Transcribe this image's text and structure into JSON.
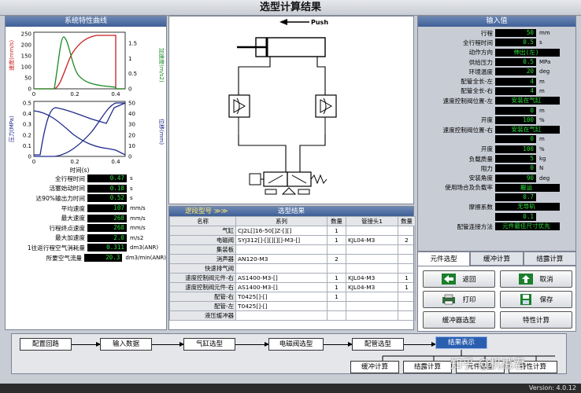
{
  "window": {
    "title": "选型计算结果",
    "version": "Version: 4.0.12"
  },
  "left_panel": {
    "header": "系统特性曲线",
    "chart1": {
      "ylabel_left": "速度(mm/s)",
      "ylabel_right": "加速度(m/s2)",
      "yticks_left": [
        "250",
        "200",
        "150",
        "100",
        "50",
        "0"
      ],
      "yticks_right": [
        "1.5",
        "1",
        "0.5",
        "0"
      ],
      "xticks": [
        "0",
        "0.2",
        "0.4"
      ]
    },
    "chart2": {
      "ylabel_left": "压力(MPa)",
      "ylabel_right": "位移(mm)",
      "yticks_left": [
        "0.5",
        "0.4",
        "0.3",
        "0.2",
        "0.1",
        "0"
      ],
      "yticks_right": [
        "50",
        "40",
        "30",
        "20",
        "10",
        "0"
      ],
      "xticks": [
        "0",
        "0.2",
        "0.4"
      ],
      "xlabel": "时间(s)"
    },
    "params": [
      {
        "label": "全行程时间",
        "value": "0.47",
        "unit": "s"
      },
      {
        "label": "活塞始动时间",
        "value": "0.18",
        "unit": "s"
      },
      {
        "label": "达90%输出力时间",
        "value": "0.52",
        "unit": "s"
      },
      {
        "label": "平均速度",
        "value": "107",
        "unit": "mm/s"
      },
      {
        "label": "最大速度",
        "value": "268",
        "unit": "mm/s"
      },
      {
        "label": "行程终点速度",
        "value": "268",
        "unit": "mm/s"
      },
      {
        "label": "最大加速度",
        "value": "2.0",
        "unit": "m/s2"
      },
      {
        "label": "1往返行程空气消耗量",
        "value": "0.311",
        "unit": "dm3(ANR)"
      },
      {
        "label": "所要空气流量",
        "value": "20.3",
        "unit": "dm3/min(ANR)"
      }
    ]
  },
  "center": {
    "push_label": "Push"
  },
  "table": {
    "tab_left": "逻段型号 ≫≫",
    "tab_center": "选型结果",
    "headers": [
      "名称",
      "系列",
      "数量",
      "管接头1",
      "数量"
    ],
    "rows": [
      [
        "气缸",
        "CJ2L[]16-50[]Z-[][]",
        "1",
        "",
        ""
      ],
      [
        "电磁阀",
        "SYJ312[]-[][][][]-M3-[]",
        "1",
        "KJL04-M3",
        "2"
      ],
      [
        "集装板",
        "",
        "",
        "",
        ""
      ],
      [
        "消声器",
        "AN120-M3",
        "2",
        "",
        ""
      ],
      [
        "快速排气阀",
        "",
        "",
        "",
        ""
      ],
      [
        "速度控制阀元件-右",
        "AS1400-M3-[]",
        "1",
        "KJL04-M3",
        "1"
      ],
      [
        "速度控制阀元件-右",
        "AS1400-M3-[]",
        "1",
        "KJL04-M3",
        "1"
      ],
      [
        "配管-右",
        "T0425[]-[]",
        "1",
        "",
        ""
      ],
      [
        "配管-左",
        "T0425[]-[]",
        "",
        "",
        ""
      ],
      [
        "液压缓冲器",
        "",
        "",
        "",
        ""
      ]
    ]
  },
  "right_panel": {
    "header": "输入值",
    "inputs": [
      {
        "label": "行程",
        "value": "50",
        "unit": "mm"
      },
      {
        "label": "全行程时间",
        "value": "0.5",
        "unit": "s"
      },
      {
        "label": "动作方向",
        "value": "伸出(左)",
        "unit": "",
        "wide": true
      },
      {
        "label": "供给压力",
        "value": "0.5",
        "unit": "MPa"
      },
      {
        "label": "环境温度",
        "value": "20",
        "unit": "deg"
      },
      {
        "label": "配管全长-左",
        "value": "4",
        "unit": "m"
      },
      {
        "label": "配管全长-右",
        "value": "4",
        "unit": "m"
      },
      {
        "label": "速度控制阀位置-左",
        "value": "安装在气缸",
        "unit": "",
        "wide": true
      },
      {
        "label": "",
        "value": "0",
        "unit": "m"
      },
      {
        "label": "开度",
        "value": "100",
        "unit": "%"
      },
      {
        "label": "速度控制阀位置-右",
        "value": "安装在气缸",
        "unit": "",
        "wide": true
      },
      {
        "label": "",
        "value": "0",
        "unit": "m"
      },
      {
        "label": "开度",
        "value": "100",
        "unit": "%"
      },
      {
        "label": "负载质量",
        "value": "5",
        "unit": "kg"
      },
      {
        "label": "阻力",
        "value": "0",
        "unit": "N"
      },
      {
        "label": "安装角度",
        "value": "90",
        "unit": "deg"
      },
      {
        "label": "使用场合及负载率",
        "value": "搬运",
        "unit": "",
        "wide": true
      },
      {
        "label": "",
        "value": "0.7",
        "unit": ""
      },
      {
        "label": "摩擦系数",
        "value": "无导轨",
        "unit": "",
        "wide": true
      },
      {
        "label": "",
        "value": "0.1",
        "unit": ""
      },
      {
        "label": "配管连接方法",
        "value": "元件最佳尺寸优先",
        "unit": "",
        "wide": true
      }
    ]
  },
  "right_tabs": [
    "元件选型",
    "缓冲计算",
    "结露计算"
  ],
  "buttons": {
    "back": "返回",
    "cancel": "取消",
    "print": "打印",
    "save": "保存",
    "buffer_select": "缓冲器选型",
    "char_calc": "特性计算"
  },
  "flow": {
    "steps": [
      "配置回路",
      "输入数据",
      "气缸选型",
      "电磁阀选型",
      "配管选型",
      "结果表示"
    ],
    "sub": [
      "缓冲计算",
      "结露计算",
      "元件选型",
      "特性计算"
    ]
  },
  "watermark": "知乎 @机械君",
  "colors": {
    "lcd_bg": "#000000",
    "lcd_text": "#2fe03a",
    "header": "#3f5f96",
    "speed": "#c81e1e",
    "accel": "#1a8a24",
    "curve": "#1f2a8a"
  }
}
